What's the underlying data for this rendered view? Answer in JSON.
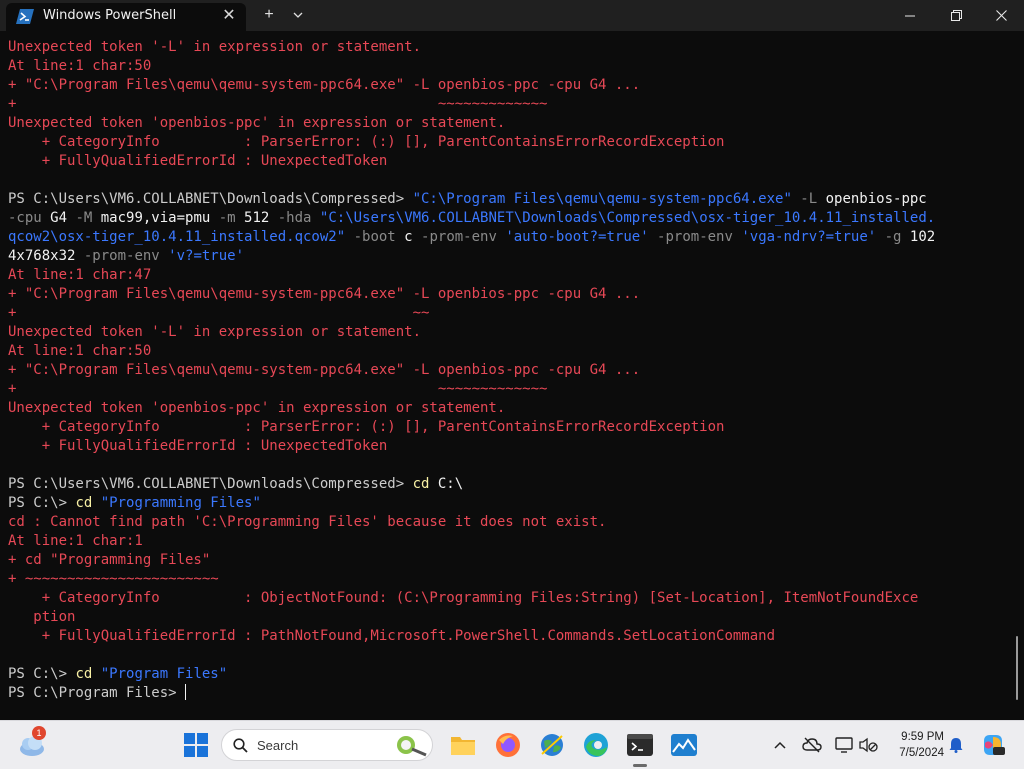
{
  "window": {
    "tab_title": "Windows PowerShell",
    "new_tab": "+",
    "dropdown": "⌄",
    "colors": {
      "error": "#e74856",
      "command": "#f9f1a5",
      "string": "#3b78ff",
      "parameter": "#8a8a8a",
      "text": "#cccccc",
      "background": "#0c0c0c"
    }
  },
  "terminal": {
    "lines": [
      "Unexpected token '-L' in expression or statement.",
      "At line:1 char:50",
      "+ \"C:\\Program Files\\qemu\\qemu-system-ppc64.exe\" -L openbios-ppc -cpu G4 ...",
      "+                                                  ~~~~~~~~~~~~~",
      "Unexpected token 'openbios-ppc' in expression or statement.",
      "    + CategoryInfo          : ParserError: (:) [], ParentContainsErrorRecordException",
      "    + FullyQualifiedErrorId : UnexpectedToken",
      "",
      {
        "prompt": "PS C:\\Users\\VM6.COLLABNET\\Downloads\\Compressed> ",
        "cmd": "\"C:\\Program Files\\qemu\\qemu-system-ppc64.exe\"",
        "p1": " -L ",
        "a1": "openbios-ppc"
      },
      "-cpu G4 -M mac99,via=pmu -m 512 -hda \"C:\\Users\\VM6.COLLABNET\\Downloads\\Compressed\\osx-tiger_10.4.11_installed.",
      "qcow2\\osx-tiger_10.4.11_installed.qcow2\" -boot c -prom-env 'auto-boot?=true' -prom-env 'vga-ndrv?=true' -g 102",
      "4x768x32 -prom-env 'v?=true'",
      "At line:1 char:47",
      "+ \"C:\\Program Files\\qemu\\qemu-system-ppc64.exe\" -L openbios-ppc -cpu G4 ...",
      "+                                               ~~",
      "Unexpected token '-L' in expression or statement.",
      "At line:1 char:50",
      "+ \"C:\\Program Files\\qemu\\qemu-system-ppc64.exe\" -L openbios-ppc -cpu G4 ...",
      "+                                                  ~~~~~~~~~~~~~",
      "Unexpected token 'openbios-ppc' in expression or statement.",
      "    + CategoryInfo          : ParserError: (:) [], ParentContainsErrorRecordException",
      "    + FullyQualifiedErrorId : UnexpectedToken",
      "",
      "PS C:\\Users\\VM6.COLLABNET\\Downloads\\Compressed> cd C:\\",
      "PS C:\\> cd \"Programming Files\"",
      "cd : Cannot find path 'C:\\Programming Files' because it does not exist.",
      "At line:1 char:1",
      "+ cd \"Programming Files\"",
      "+ ~~~~~~~~~~~~~~~~~~~~~~~",
      "    + CategoryInfo          : ObjectNotFound: (C:\\Programming Files:String) [Set-Location], ItemNotFoundExce",
      "   ption",
      "    + FullyQualifiedErrorId : PathNotFound,Microsoft.PowerShell.Commands.SetLocationCommand",
      "",
      "PS C:\\> cd \"Program Files\"",
      "PS C:\\Program Files> "
    ],
    "wrap_line": {
      "p_cpu": "-cpu ",
      "v_cpu": "G4",
      "p_M": " -M ",
      "v_M": "mac99,via=pmu",
      "p_m": " -m ",
      "v_m": "512",
      "p_hda": " -hda ",
      "v_hda": "\"C:\\Users\\VM6.COLLABNET\\Downloads\\Compressed\\osx-tiger_10.4.11_installed."
    },
    "wrap_line2": {
      "v_hda2": "qcow2\\osx-tiger_10.4.11_installed.qcow2\"",
      "p_boot": " -boot ",
      "v_boot": "c",
      "p_pe1": " -prom-env ",
      "v_pe1": "'auto-boot?=true'",
      "p_pe2": " -prom-env ",
      "v_pe2": "'vga-ndrv?=true'",
      "p_g": " -g ",
      "v_g": "102"
    },
    "wrap_line3": {
      "v_g2": "4x768x32",
      "p_pe3": " -prom-env ",
      "v_pe3": "'v?=true'"
    }
  },
  "taskbar": {
    "search_placeholder": "Search",
    "weather_badge": "1",
    "clock_time": "9:59 PM",
    "clock_date": "7/5/2024",
    "icons": [
      "weather-icon",
      "start-icon",
      "search-icon",
      "file-explorer-icon",
      "firefox-icon",
      "network-globe-icon",
      "edge-icon",
      "terminal-icon",
      "photos-icon",
      "chevron-up-icon",
      "network-icon",
      "volume-icon",
      "notification-icon",
      "copilot-icon"
    ]
  }
}
